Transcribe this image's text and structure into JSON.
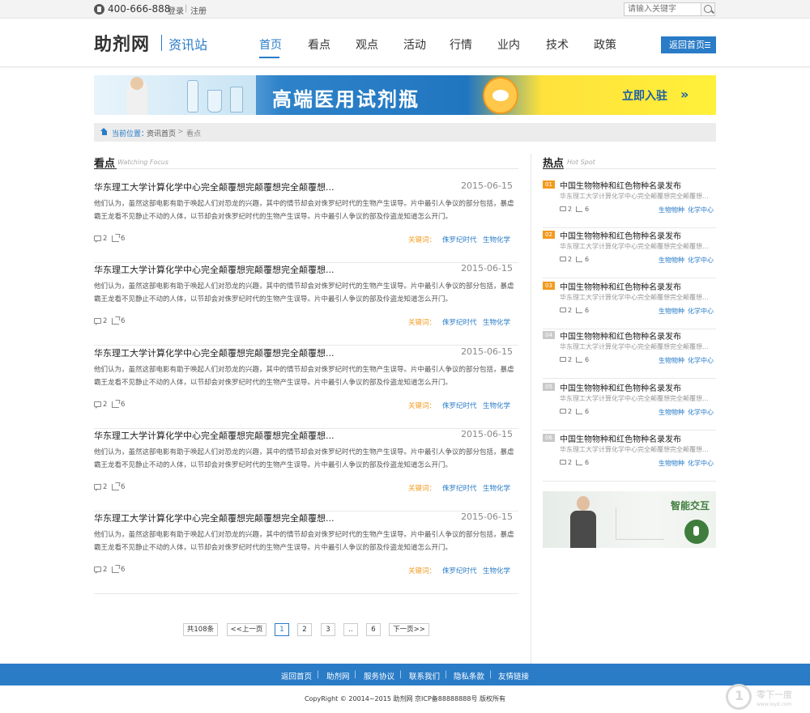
{
  "topbar": {
    "phone": "400-666-888",
    "login": "登录",
    "separator": "|",
    "register": "注册",
    "search_placeholder": "请输入关键字"
  },
  "header": {
    "logo": "助剂网",
    "logo_sub": "资讯站",
    "nav": [
      "首页",
      "看点",
      "观点",
      "活动",
      "行情",
      "业内",
      "技术",
      "政策"
    ],
    "active_nav": "首页",
    "back_home": "返回首页"
  },
  "banner": {
    "title": "高端医用试剂瓶",
    "cta": "立即入驻",
    "cta_arrow": "»"
  },
  "breadcrumb": {
    "label": "当前位置：",
    "level1": "资讯首页",
    "sep": ">",
    "level2": "看点"
  },
  "main": {
    "section_title": "看点",
    "section_sub": "Watching Focus",
    "articles": [
      {
        "title": "华东理工大学计算化学中心完全颠覆想完颠覆想完全颠覆想...",
        "date": "2015-06-15",
        "summary": "他们认为，虽然这部电影有助于唤起人们对恐龙的兴趣，其中的情节却会对侏罗纪时代的生物产生误导。片中最引人争议的部分包括，暴虐霸王龙看不见静止不动的人体，以节却会对侏罗纪时代的生物产生误导。片中最引人争议的部及伶盗龙知道怎么开门。",
        "comments": "2",
        "shares": "6",
        "kw_label": "关键词：",
        "kw1": "侏罗纪时代",
        "kw2": "生物化学"
      },
      {
        "title": "华东理工大学计算化学中心完全颠覆想完颠覆想完全颠覆想...",
        "date": "2015-06-15",
        "summary": "他们认为，虽然这部电影有助于唤起人们对恐龙的兴趣，其中的情节却会对侏罗纪时代的生物产生误导。片中最引人争议的部分包括，暴虐霸王龙看不见静止不动的人体，以节却会对侏罗纪时代的生物产生误导。片中最引人争议的部及伶盗龙知道怎么开门。",
        "comments": "2",
        "shares": "6",
        "kw_label": "关键词：",
        "kw1": "侏罗纪时代",
        "kw2": "生物化学"
      },
      {
        "title": "华东理工大学计算化学中心完全颠覆想完颠覆想完全颠覆想...",
        "date": "2015-06-15",
        "summary": "他们认为，虽然这部电影有助于唤起人们对恐龙的兴趣，其中的情节却会对侏罗纪时代的生物产生误导。片中最引人争议的部分包括，暴虐霸王龙看不见静止不动的人体，以节却会对侏罗纪时代的生物产生误导。片中最引人争议的部及伶盗龙知道怎么开门。",
        "comments": "2",
        "shares": "6",
        "kw_label": "关键词：",
        "kw1": "侏罗纪时代",
        "kw2": "生物化学"
      },
      {
        "title": "华东理工大学计算化学中心完全颠覆想完颠覆想完全颠覆想...",
        "date": "2015-06-15",
        "summary": "他们认为，虽然这部电影有助于唤起人们对恐龙的兴趣，其中的情节却会对侏罗纪时代的生物产生误导。片中最引人争议的部分包括，暴虐霸王龙看不见静止不动的人体，以节却会对侏罗纪时代的生物产生误导。片中最引人争议的部及伶盗龙知道怎么开门。",
        "comments": "2",
        "shares": "6",
        "kw_label": "关键词：",
        "kw1": "侏罗纪时代",
        "kw2": "生物化学"
      },
      {
        "title": "华东理工大学计算化学中心完全颠覆想完颠覆想完全颠覆想...",
        "date": "2015-06-15",
        "summary": "他们认为，虽然这部电影有助于唤起人们对恐龙的兴趣，其中的情节却会对侏罗纪时代的生物产生误导。片中最引人争议的部分包括，暴虐霸王龙看不见静止不动的人体，以节却会对侏罗纪时代的生物产生误导。片中最引人争议的部及伶盗龙知道怎么开门。",
        "comments": "2",
        "shares": "6",
        "kw_label": "关键词：",
        "kw1": "侏罗纪时代",
        "kw2": "生物化学"
      }
    ]
  },
  "pagination": {
    "total": "共108条",
    "prev": "<<上一页",
    "pages": [
      "1",
      "2",
      "3",
      "..",
      "6"
    ],
    "current": "1",
    "next": "下一页>>"
  },
  "sidebar": {
    "section_title": "热点",
    "section_sub": "Hot Spot",
    "items": [
      {
        "rank": "01",
        "title": "中国生物物种和红色物种名录发布",
        "summary": "华东理工大学计算化学中心完全颠覆想完全颠覆想...",
        "comments": "2",
        "shares": "6",
        "kw1": "生物物种",
        "kw2": "化学中心"
      },
      {
        "rank": "02",
        "title": "中国生物物种和红色物种名录发布",
        "summary": "华东理工大学计算化学中心完全颠覆想完全颠覆想...",
        "comments": "2",
        "shares": "6",
        "kw1": "生物物种",
        "kw2": "化学中心"
      },
      {
        "rank": "03",
        "title": "中国生物物种和红色物种名录发布",
        "summary": "华东理工大学计算化学中心完全颠覆想完全颠覆想...",
        "comments": "2",
        "shares": "6",
        "kw1": "生物物种",
        "kw2": "化学中心"
      },
      {
        "rank": "04",
        "title": "中国生物物种和红色物种名录发布",
        "summary": "华东理工大学计算化学中心完全颠覆想完全颠覆想...",
        "comments": "2",
        "shares": "6",
        "kw1": "生物物种",
        "kw2": "化学中心"
      },
      {
        "rank": "05",
        "title": "中国生物物种和红色物种名录发布",
        "summary": "华东理工大学计算化学中心完全颠覆想完全颠覆想...",
        "comments": "2",
        "shares": "6",
        "kw1": "生物物种",
        "kw2": "化学中心"
      },
      {
        "rank": "06",
        "title": "中国生物物种和红色物种名录发布",
        "summary": "华东理工大学计算化学中心完全颠覆想完全颠覆想...",
        "comments": "2",
        "shares": "6",
        "kw1": "生物物种",
        "kw2": "化学中心"
      }
    ],
    "ad_title": "智能交互"
  },
  "footer": {
    "links": [
      "返回首页",
      "助剂网",
      "服务协议",
      "联系我们",
      "隐私条款",
      "友情链接"
    ],
    "separator": "|",
    "copyright": "CopyRight © 20014~2015 助剂网 京ICP备88888888号 版权所有"
  },
  "watermark": {
    "text": "零下一度",
    "url": "www.lxyd.com"
  },
  "colors": {
    "accent": "#2a7cc7",
    "keyword_label": "#f39a1e",
    "rank_top": "#f39a1e",
    "rank_rest": "#c9c9c9"
  }
}
